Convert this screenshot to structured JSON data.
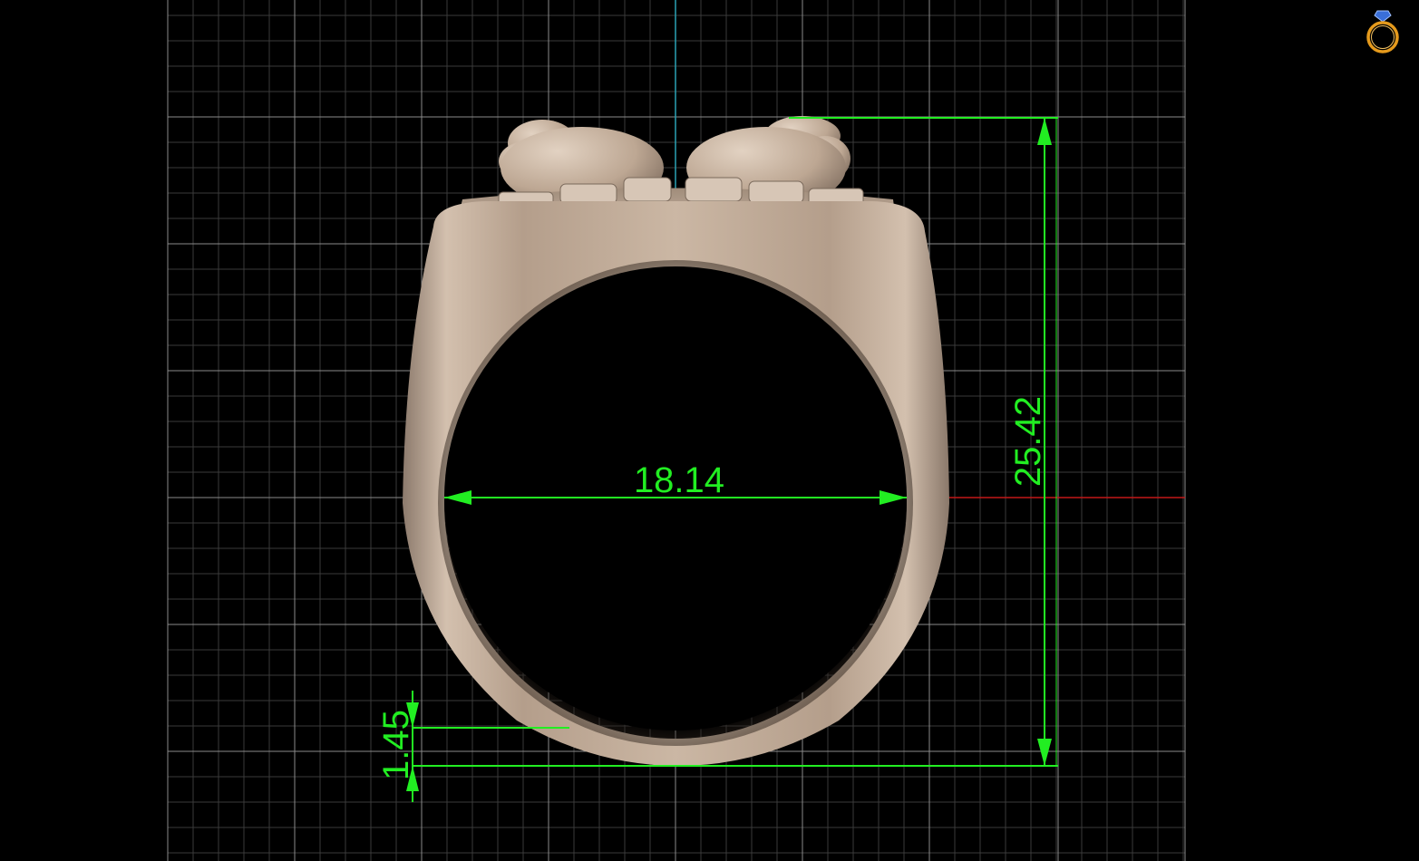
{
  "colors": {
    "background": "#000000",
    "grid_major": "#8a8a8a",
    "grid_minor": "#3a3a3a",
    "axis_vertical": "#2aa3b5",
    "axis_horizontal": "#c21818",
    "dimension": "#22ee22",
    "ring_metal": "#c9b5a3",
    "icon_gold": "#e59a1c",
    "icon_gem": "#3a6fd8"
  },
  "dimensions": {
    "inner_diameter": "18.14",
    "total_height": "25.42",
    "band_thickness": "1.45"
  },
  "icons": {
    "brand": "ring-logo-icon"
  }
}
